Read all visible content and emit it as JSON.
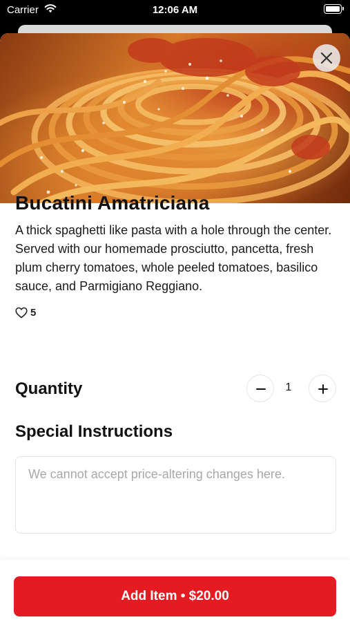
{
  "status_bar": {
    "carrier": "Carrier",
    "time": "12:06 AM",
    "icons": [
      "wifi-icon",
      "battery-icon"
    ]
  },
  "hero": {
    "image": "bucatini-pasta-photo",
    "close_icon": "close-icon"
  },
  "item": {
    "title": "Bucatini Amatriciana",
    "description": "A thick spaghetti like pasta with a hole through the center. Served with our homemade prosciutto, pancetta, fresh plum cherry tomatoes, whole peeled tomatoes, basilico sauce, and Parmigiano Reggiano.",
    "likes": "5"
  },
  "quantity": {
    "label": "Quantity",
    "value": "1"
  },
  "instructions": {
    "label": "Special Instructions",
    "placeholder": "We cannot accept price-altering changes here."
  },
  "footer": {
    "add_button_label": "Add Item • $20.00"
  },
  "colors": {
    "accent": "#e51b23",
    "text": "#111111",
    "placeholder": "#a8a8a8"
  }
}
